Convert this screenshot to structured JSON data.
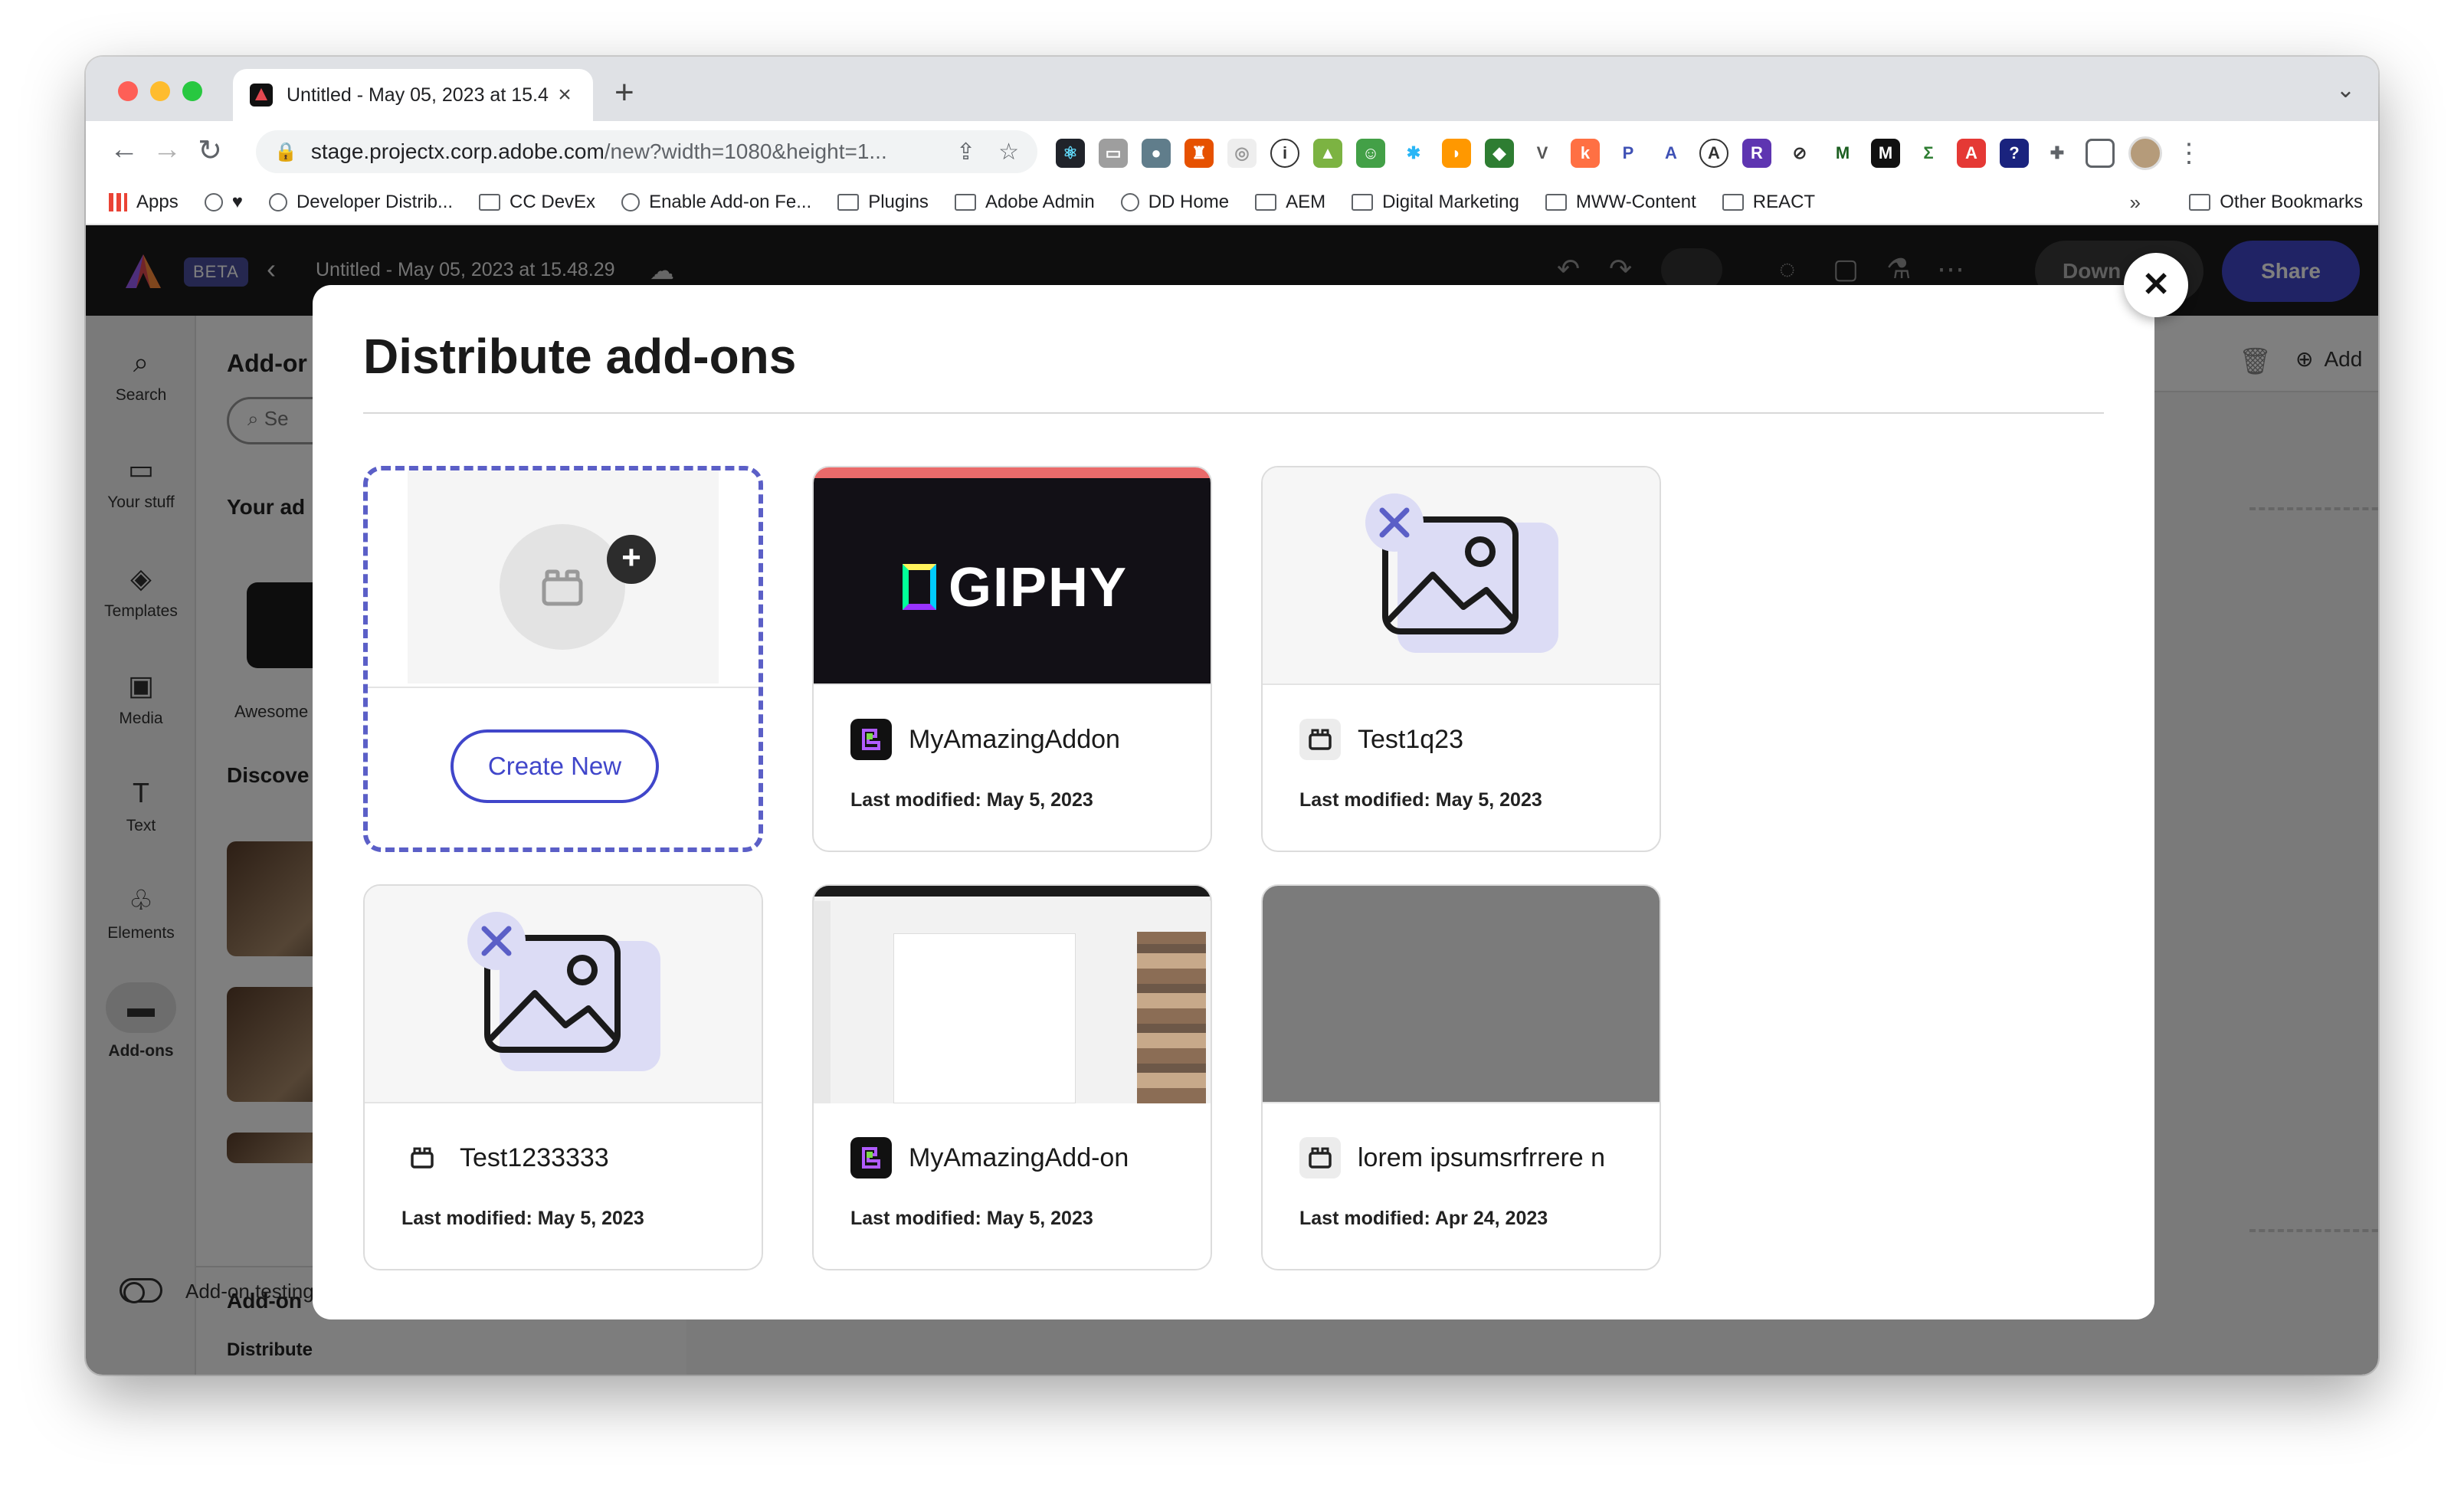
{
  "browser": {
    "tab_title": "Untitled - May 05, 2023 at 15.4",
    "url_host": "stage.projectx.corp.adobe.com",
    "url_path": "/new?width=1080&height=1...",
    "bookmarks": [
      "Apps",
      "Developer Distrib...",
      "CC DevEx",
      "Enable Add-on Fe...",
      "Plugins",
      "Adobe Admin",
      "DD Home",
      "AEM",
      "Digital Marketing",
      "MWW-Content",
      "REACT"
    ],
    "bookmarks_more": "»",
    "other_bookmarks": "Other Bookmarks"
  },
  "app": {
    "beta": "BETA",
    "doc_title": "Untitled - May 05, 2023 at 15.48.29",
    "download_label": "Down",
    "share_label": "Share",
    "rail": [
      {
        "label": "Search",
        "icon": "search-icon"
      },
      {
        "label": "Your stuff",
        "icon": "folder-icon"
      },
      {
        "label": "Templates",
        "icon": "templates-icon"
      },
      {
        "label": "Media",
        "icon": "media-icon"
      },
      {
        "label": "Text",
        "icon": "text-icon"
      },
      {
        "label": "Elements",
        "icon": "elements-icon"
      },
      {
        "label": "Add-ons",
        "icon": "addons-icon"
      }
    ],
    "panel": {
      "heading": "Add-or",
      "search_placeholder": "Se",
      "your_addons": "Your ad",
      "addon_caption": "Awesome",
      "discover": "Discove",
      "bottom_heading": "Add-on",
      "distribute": "Distribute",
      "toggle_label": "Add-on testing"
    },
    "canvas": {
      "add_label": "Add"
    }
  },
  "modal": {
    "title": "Distribute add-ons",
    "create_label": "Create New",
    "cards": [
      {
        "name": "MyAmazingAddon",
        "modified": "Last modified: May 5, 2023"
      },
      {
        "name": "Test1q23",
        "modified": "Last modified: May 5, 2023"
      },
      {
        "name": "Test1233333",
        "modified": "Last modified: May 5, 2023"
      },
      {
        "name": "MyAmazingAdd-on",
        "modified": "Last modified: May 5, 2023"
      },
      {
        "name": "lorem ipsumsrfrrere n",
        "modified": "Last modified: Apr 24, 2023"
      }
    ],
    "giphy_word": "GIPHY"
  }
}
